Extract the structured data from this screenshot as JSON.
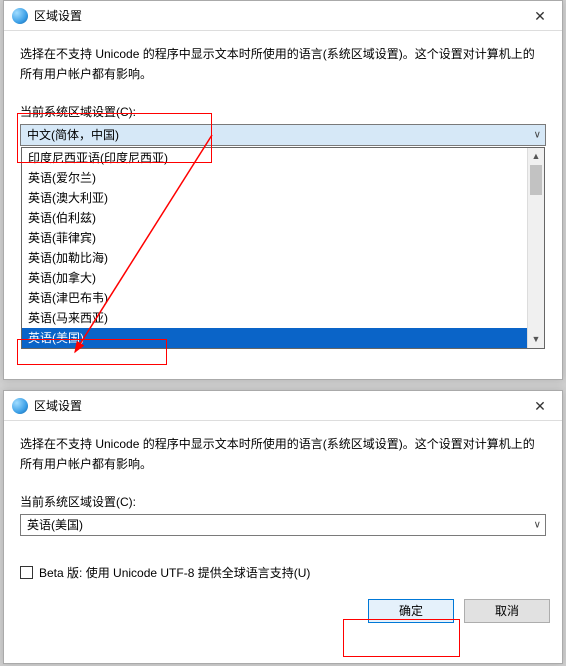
{
  "dialog1": {
    "title": "区域设置",
    "close_glyph": "✕",
    "description": "选择在不支持 Unicode 的程序中显示文本时所使用的语言(系统区域设置)。这个设置对计算机上的所有用户帐户都有影响。",
    "field_label": "当前系统区域设置(C):",
    "selected_value": "中文(简体，中国)",
    "dropdown_options": [
      "印度尼西亚语(印度尼西亚)",
      "英语(爱尔兰)",
      "英语(澳大利亚)",
      "英语(伯利兹)",
      "英语(菲律宾)",
      "英语(加勒比海)",
      "英语(加拿大)",
      "英语(津巴布韦)",
      "英语(马来西亚)",
      "英语(美国)"
    ],
    "highlight_index": 9,
    "chevron_glyph": "∨",
    "sb_up": "▲",
    "sb_down": "▼"
  },
  "dialog2": {
    "title": "区域设置",
    "close_glyph": "✕",
    "description": "选择在不支持 Unicode 的程序中显示文本时所使用的语言(系统区域设置)。这个设置对计算机上的所有用户帐户都有影响。",
    "field_label": "当前系统区域设置(C):",
    "selected_value": "英语(美国)",
    "chevron_glyph": "∨",
    "checkbox_label": "Beta 版: 使用 Unicode UTF-8 提供全球语言支持(U)",
    "ok_label": "确定",
    "cancel_label": "取消"
  }
}
